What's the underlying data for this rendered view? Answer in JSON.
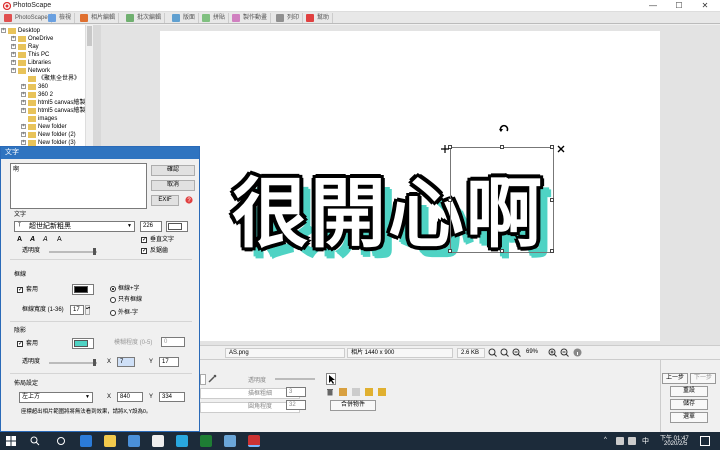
{
  "app": {
    "title": "PhotoScape",
    "min": "—",
    "max": "☐",
    "close": "✕"
  },
  "tabs": [
    {
      "label": "PhotoScape",
      "color": "#e05050"
    },
    {
      "label": "檢視",
      "color": "#6aa0e0"
    },
    {
      "label": "相片編輯",
      "color": "#e07030"
    },
    {
      "label": "批次編輯",
      "color": "#70b070"
    },
    {
      "label": "版面",
      "color": "#60a0d0"
    },
    {
      "label": "拼貼",
      "color": "#80c080"
    },
    {
      "label": "製作動畫",
      "color": "#d080c0"
    },
    {
      "label": "列印",
      "color": "#909090"
    },
    {
      "label": "幫助",
      "color": "#e04040"
    }
  ],
  "tree": [
    "Desktop",
    "OneDrive",
    "Ray",
    "This PC",
    "Libraries",
    "Network",
    "《聚焦全世界》",
    "360",
    "360 2",
    "html5 canvas繪製3",
    "html5 canvas繪製3",
    "images",
    "New folder",
    "New folder (2)",
    "New folder (3)"
  ],
  "canvas": {
    "text": "很開心啊",
    "text_fill": "#ffffff",
    "outline": "#000000",
    "shadow": "#4fd3c4"
  },
  "status": {
    "filename": "AS.png",
    "dims": "相片 1440 x 900",
    "size": "2.6 KB",
    "zoom": "69%"
  },
  "bottom": {
    "opacity": "透明度",
    "edge_width": "描框粗細",
    "corner": "圓角程度",
    "edge_val": "3",
    "corner_val": "32",
    "merge_btn": "合併物件",
    "undo": "上一步",
    "redo": "下一步",
    "reset": "重設",
    "save": "儲存",
    "menu": "選單"
  },
  "dialog": {
    "title": "文字",
    "content": "啊",
    "ok": "確認",
    "cancel": "取消",
    "exif": "EXIF",
    "text_section": "文字",
    "font": "超世紀新粗黑",
    "font_size": "226",
    "vertical": "垂直文字",
    "antialias": "反鋸齒",
    "opacity": "透明度",
    "border_section": "框線",
    "border_enable": "套用",
    "border_color": "#000000",
    "border_opt1": "框線+字",
    "border_opt2": "只有框線",
    "border_opt3": "外框-字",
    "border_width_label": "框線寬度 (1-36)",
    "border_width": "17",
    "shadow_section": "陰影",
    "shadow_enable": "套用",
    "shadow_color": "#4fd3c4",
    "blur_label": "模糊程度 (0-5)",
    "blur": "0",
    "shadow_opacity": "透明度",
    "x_label": "X",
    "shadow_x": "7",
    "y_label": "Y",
    "shadow_y": "17",
    "pos_section": "佈局設定",
    "pos": "左上方",
    "pos_x_label": "X",
    "pos_x": "840",
    "pos_y_label": "Y",
    "pos_y": "334",
    "hint": "座標超出相片範圍將將無法看到效果，請將X,Y設為0。"
  },
  "taskbar": {
    "time": "下午 01:47",
    "date": "2020/2/5",
    "lang": "中"
  }
}
